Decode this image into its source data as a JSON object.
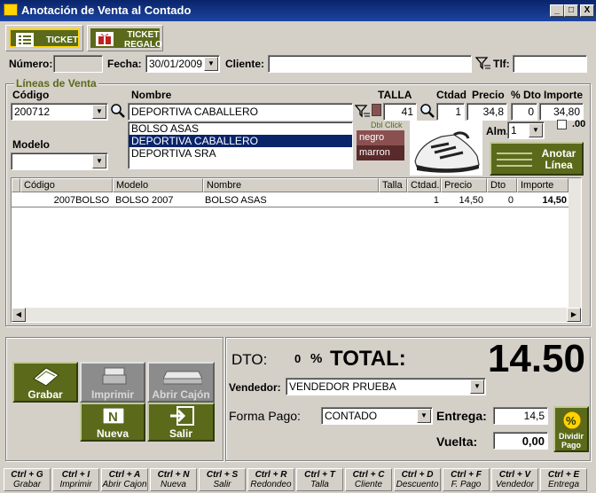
{
  "window": {
    "title": "Anotación de Venta al Contado",
    "min": "_",
    "max": "□",
    "close": "X"
  },
  "tabs": {
    "ticket": "TICKET",
    "ticket_regalo_1": "TICKET",
    "ticket_regalo_2": "REGALO"
  },
  "header": {
    "numero_label": "Número:",
    "numero_value": "",
    "fecha_label": "Fecha:",
    "fecha_value": "30/01/2009",
    "cliente_label": "Cliente:",
    "cliente_value": "",
    "tlf_label": "Tlf:",
    "tlf_value": ""
  },
  "lineas": {
    "group_label": "Líneas de Venta",
    "codigo_label": "Código",
    "codigo_value": "200712",
    "nombre_label": "Nombre",
    "nombre_value": "DEPORTIVA CABALLERO",
    "nombre_options": [
      "BOLSO ASAS",
      "DEPORTIVA CABALLERO",
      "DEPORTIVA SRA"
    ],
    "modelo_label": "Modelo",
    "modelo_value": "",
    "talla_label": "TALLA",
    "talla_value": "41",
    "dblclick_label": "Dbl Click",
    "colors": [
      "negro",
      "marron"
    ],
    "ctdad_label": "Ctdad",
    "ctdad_value": "1",
    "precio_label": "Precio",
    "precio_value": "34,8",
    "dto_label": "% Dto",
    "dto_value": "0",
    "importe_label": "Importe",
    "importe_value": "34,80",
    "cents_label": ".00",
    "alm_label": "Alm.:",
    "alm_value": "1",
    "anotar_1": "Anotar",
    "anotar_2": "Línea"
  },
  "grid": {
    "headers": [
      "Código",
      "Modelo",
      "Nombre",
      "Talla",
      "Ctdad.",
      "Precio",
      "Dto",
      "Importe"
    ],
    "rows": [
      {
        "codigo": "2007BOLSO",
        "modelo": "BOLSO 2007",
        "nombre": "BOLSO ASAS",
        "talla": "",
        "ctdad": "1",
        "precio": "14,50",
        "dto": "0",
        "importe": "14,50"
      }
    ]
  },
  "actions": {
    "grabar": "Grabar",
    "imprimir": "Imprimir",
    "abrir_cajon": "Abrir Cajón",
    "nueva": "Nueva",
    "salir": "Salir"
  },
  "totals": {
    "dto_label": "DTO:",
    "dto_value": "0",
    "percent": "%",
    "total_label": "TOTAL:",
    "total_value": "14.50",
    "vendedor_label": "Vendedor:",
    "vendedor_value": "VENDEDOR PRUEBA",
    "forma_pago_label": "Forma Pago:",
    "forma_pago_value": "CONTADO",
    "entrega_label": "Entrega:",
    "entrega_value": "14,5",
    "vuelta_label": "Vuelta:",
    "vuelta_value": "0,00",
    "dividir_1": "Dividir",
    "dividir_2": "Pago"
  },
  "shortcuts": [
    {
      "keys": "Ctrl + G",
      "label": "Grabar"
    },
    {
      "keys": "Ctrl + I",
      "label": "Imprimir"
    },
    {
      "keys": "Ctrl + A",
      "label": "Abrir Cajon"
    },
    {
      "keys": "Ctrl + N",
      "label": "Nueva"
    },
    {
      "keys": "Ctrl + S",
      "label": "Salir"
    },
    {
      "keys": "Ctrl + R",
      "label": "Redondeo"
    },
    {
      "keys": "Ctrl + T",
      "label": "Talla"
    },
    {
      "keys": "Ctrl + C",
      "label": "Cliente"
    },
    {
      "keys": "Ctrl + D",
      "label": "Descuento"
    },
    {
      "keys": "Ctrl + F",
      "label": "F. Pago"
    },
    {
      "keys": "Ctrl + V",
      "label": "Vendedor"
    },
    {
      "keys": "Ctrl + E",
      "label": "Entrega"
    }
  ],
  "colors": {
    "accent": "#5a6a1a",
    "title": "#0a246a"
  }
}
